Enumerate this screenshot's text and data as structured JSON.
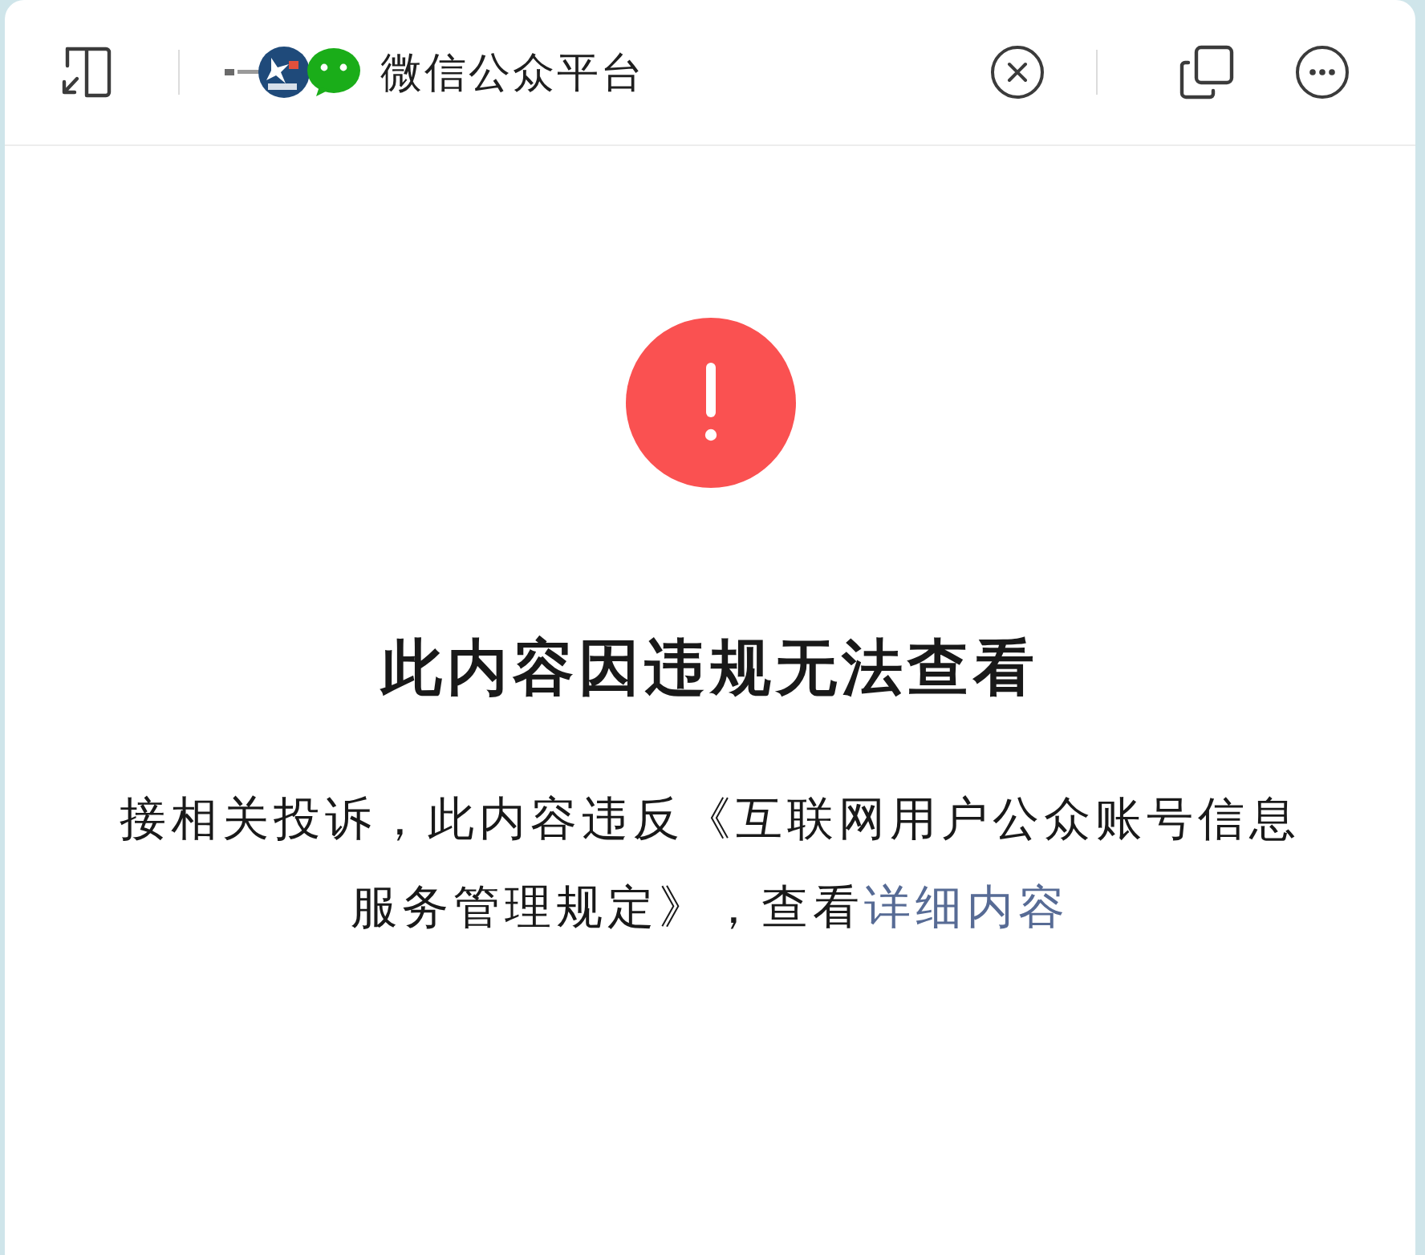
{
  "toolbar": {
    "title": "微信公众平台"
  },
  "notice": {
    "heading": "此内容因违规无法查看",
    "message": "接相关投诉，此内容违反《互联网用户公众账号信息服务管理规定》，查看",
    "link": "详细内容"
  }
}
